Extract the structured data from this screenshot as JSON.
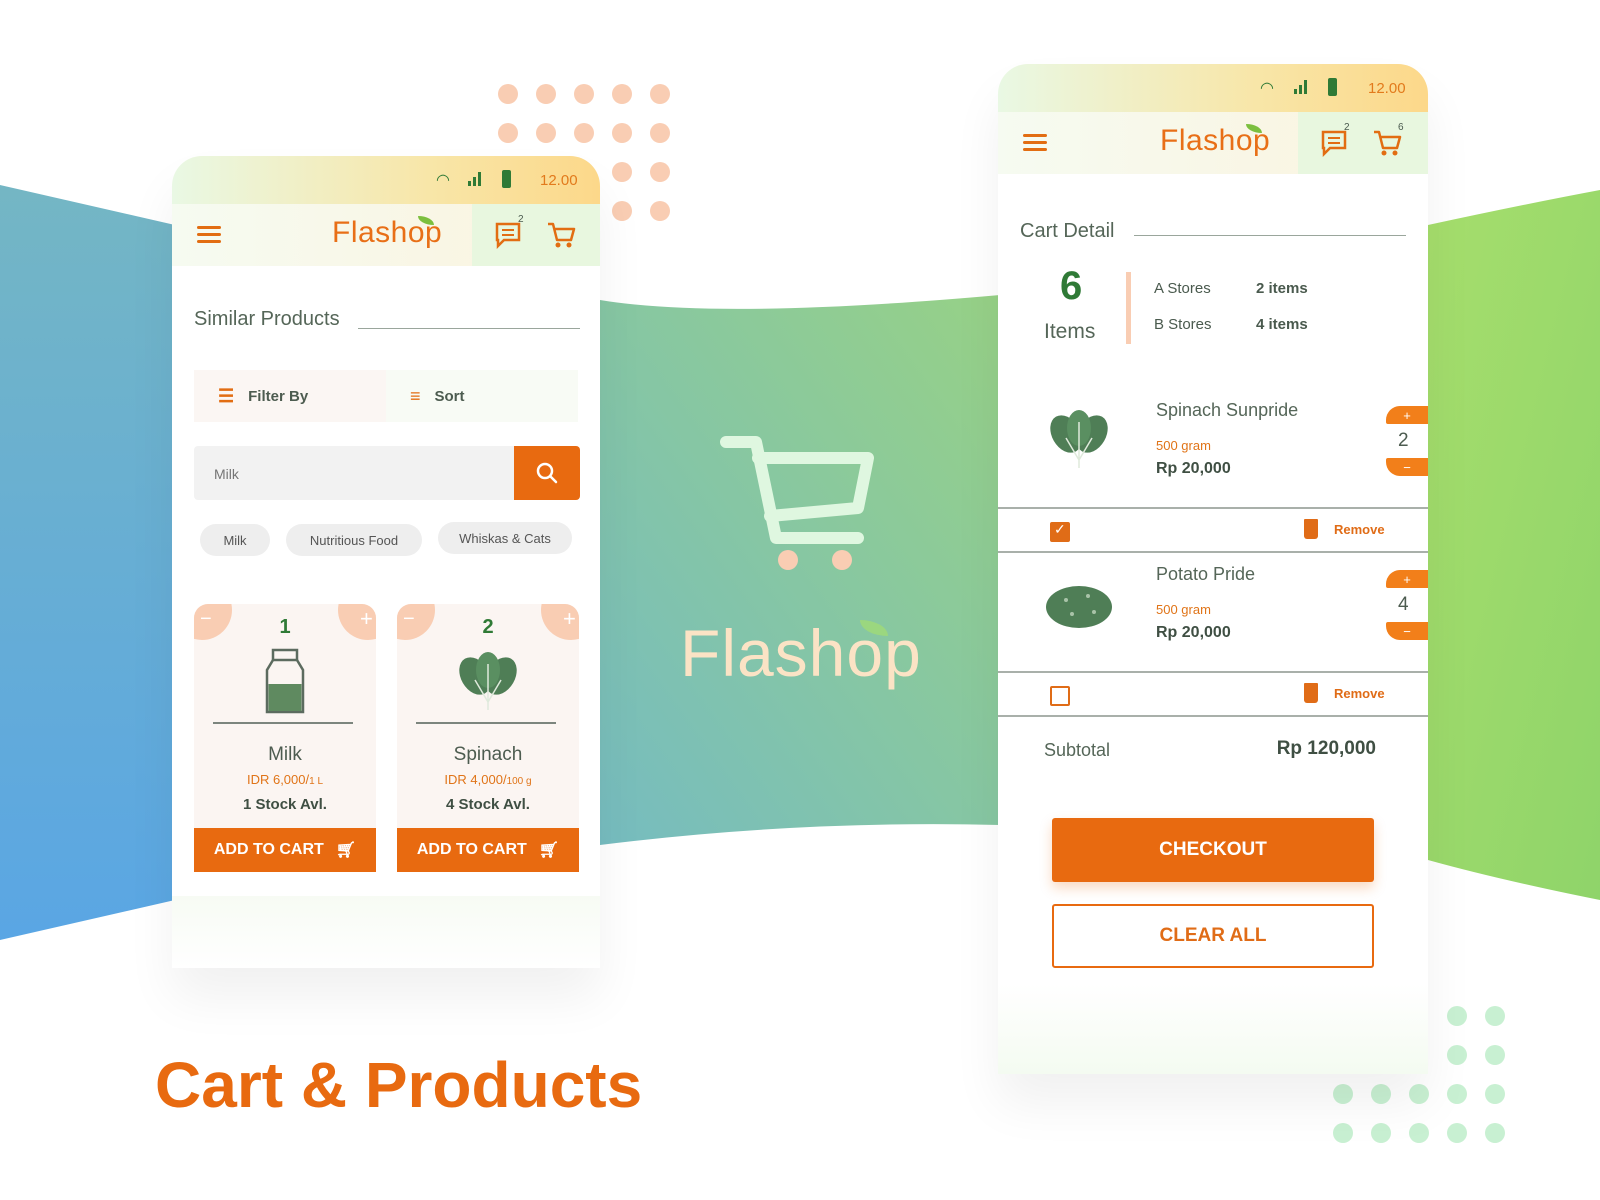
{
  "headline": "Cart & Products",
  "center_logo": {
    "text": "Flashop"
  },
  "colors": {
    "accent": "#e86a10",
    "green": "#2f7a36",
    "peach": "#f9cdb3",
    "mint": "#c8f0d2"
  },
  "left_phone": {
    "status_time": "12.00",
    "logo": "Flashop",
    "chat_badge": "2",
    "section_title": "Similar Products",
    "filter_label": "Filter By",
    "sort_label": "Sort",
    "search_placeholder": "Milk",
    "chips": [
      "Milk",
      "Nutritious Food",
      "Whiskas & Cats"
    ],
    "products": [
      {
        "qty": "1",
        "name": "Milk",
        "price": "IDR 6,000/",
        "unit": "1 L",
        "stock": "1 Stock Avl.",
        "button": "ADD TO CART",
        "icon": "milk-icon"
      },
      {
        "qty": "2",
        "name": "Spinach",
        "price": "IDR 4,000/",
        "unit": "100 g",
        "stock": "4 Stock Avl.",
        "button": "ADD TO CART",
        "icon": "spinach-icon"
      }
    ]
  },
  "right_phone": {
    "status_time": "12.00",
    "logo": "Flashop",
    "chat_badge": "2",
    "cart_badge": "6",
    "section_title": "Cart Detail",
    "total_count": "6",
    "total_label": "Items",
    "stores": [
      {
        "name": "A Stores",
        "count": "2 items"
      },
      {
        "name": "B Stores",
        "count": "4 items"
      }
    ],
    "items": [
      {
        "name": "Spinach Sunpride",
        "weight": "500 gram",
        "price": "Rp 20,000",
        "qty": "2",
        "checked": true,
        "remove": "Remove"
      },
      {
        "name": "Potato Pride",
        "weight": "500 gram",
        "price": "Rp 20,000",
        "qty": "4",
        "checked": false,
        "remove": "Remove"
      }
    ],
    "subtotal_label": "Subtotal",
    "subtotal_value": "Rp 120,000",
    "checkout_label": "CHECKOUT",
    "clear_label": "CLEAR ALL"
  }
}
